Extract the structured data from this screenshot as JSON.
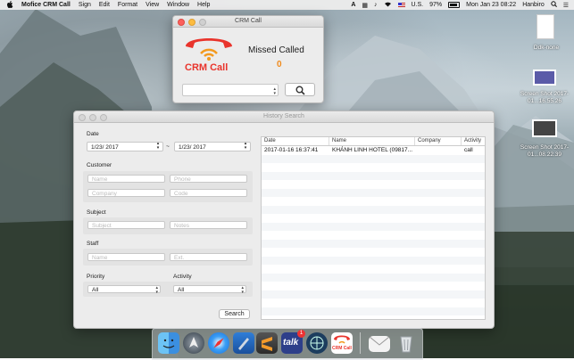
{
  "menubar": {
    "apple": "",
    "app_name": "Mofice CRM Call",
    "items": [
      "Sign",
      "Edit",
      "Format",
      "View",
      "Window",
      "Help"
    ],
    "status": {
      "input_source": "U.S.",
      "battery": "97%",
      "datetime": "Mon Jan 23  08:22",
      "user": "Hanbiro"
    }
  },
  "desktop_icons": [
    {
      "label": "Ddk-none",
      "icon": "document-icon"
    },
    {
      "label": "Screen Shot 2017-01...16.55.26",
      "icon": "screenshot-thumbnail-icon"
    },
    {
      "label": "Screen Shot 2017-01...08.22.39",
      "icon": "screenshot-thumbnail-icon"
    }
  ],
  "crm_window": {
    "title": "CRM Call",
    "logo_text": "CRM Call",
    "missed_label": "Missed Called",
    "missed_count": "0",
    "search_icon": "magnifier-icon"
  },
  "history_window": {
    "title": "History Search",
    "date": {
      "label": "Date",
      "from": "1/23/ 2017",
      "to": "1/23/ 2017",
      "separator": "~"
    },
    "customer": {
      "label": "Customer",
      "name_placeholder": "Name",
      "phone_placeholder": "Phone",
      "company_placeholder": "Company",
      "code_placeholder": "Code"
    },
    "subject": {
      "label": "Subject",
      "subject_placeholder": "Subject",
      "notes_placeholder": "Notes"
    },
    "staff": {
      "label": "Staff",
      "name_placeholder": "Name",
      "ext_placeholder": "Ext."
    },
    "priority": {
      "label": "Priority",
      "value": "All"
    },
    "activity": {
      "label": "Activity",
      "value": "All"
    },
    "search_button": "Search",
    "table": {
      "columns": [
        "Date",
        "Name",
        "Company",
        "Activity"
      ],
      "rows": [
        {
          "date": "2017-01-16 16:37:41",
          "name": "KHÁNH LINH HOTEL (09817...",
          "company": "",
          "activity": "call"
        }
      ]
    }
  },
  "dock": {
    "items": [
      "finder-icon",
      "launchpad-icon",
      "safari-icon",
      "xcode-icon",
      "sublime-icon",
      "talk-icon",
      "network-icon",
      "crm-call-icon",
      "mail-icon",
      "trash-icon"
    ],
    "talk_label": "talk",
    "talk_badge": "1",
    "crm_label": "CRM Call"
  },
  "colors": {
    "accent_red": "#e9342c",
    "accent_orange": "#f39a1e",
    "missed_count": "#f08a1b"
  }
}
